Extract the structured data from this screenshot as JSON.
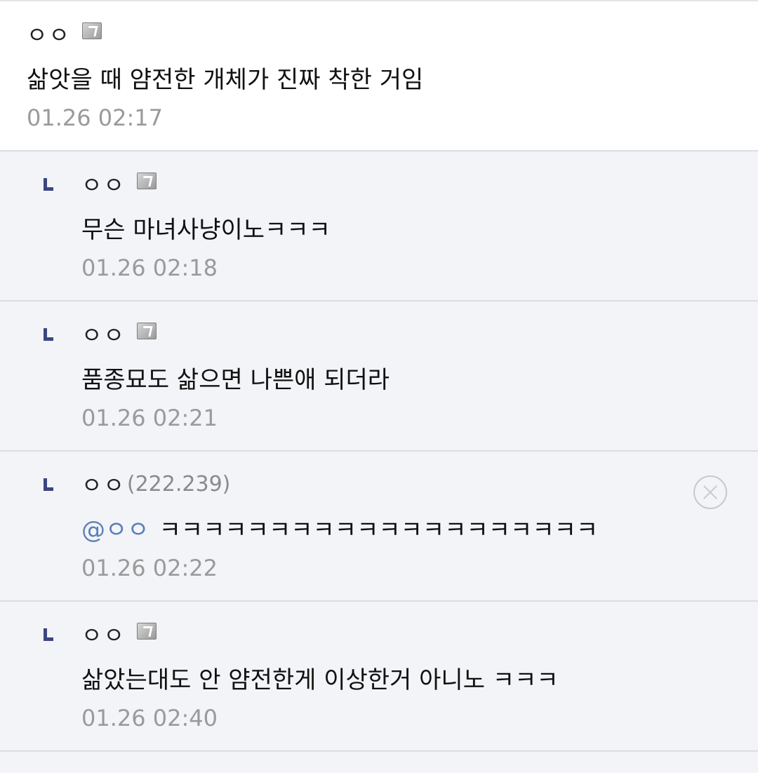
{
  "comments": [
    {
      "nick": "ㅇㅇ",
      "text": "삶앗을 때 얌전한 개체가 진짜 착한 거임",
      "date": "01.26 02:17"
    },
    {
      "nick": "ㅇㅇ",
      "text": "무슨 마녀사냥이노ㅋㅋㅋ",
      "date": "01.26 02:18"
    },
    {
      "nick": "ㅇㅇ",
      "text": "품종묘도 삶으면 나쁜애 되더라",
      "date": "01.26 02:21"
    },
    {
      "nick": "ㅇㅇ",
      "ip": "(222.239)",
      "mention": "@ㅇㅇ",
      "text": "ㅋㅋㅋㅋㅋㅋㅋㅋㅋㅋㅋㅋㅋㅋㅋㅋㅋㅋㅋㅋ",
      "date": "01.26 02:22"
    },
    {
      "nick": "ㅇㅇ",
      "text": "삶았는대도 안 얌전한게 이상한거 아니노 ㅋㅋㅋ",
      "date": "01.26 02:40"
    }
  ],
  "icons": {
    "reply": "reply-arrow-icon",
    "fixed_nick": "fixed-nick-icon",
    "delete": "delete-icon"
  },
  "colors": {
    "reply_bg": "#f3f4f8",
    "reply_arrow": "#3b4680",
    "mention": "#5a7fb8",
    "date": "#9a9a9a"
  }
}
